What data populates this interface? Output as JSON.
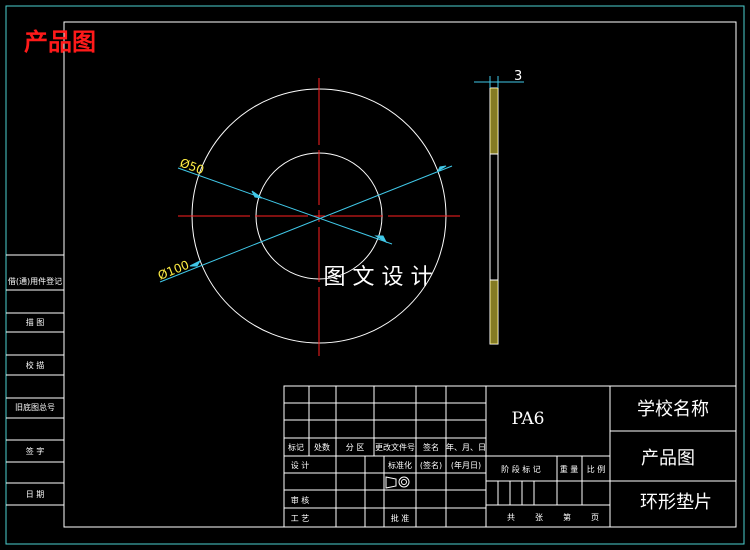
{
  "title": "产品图",
  "watermark": "图 文 设 计",
  "dimensions": {
    "inner_diameter": "Ø50",
    "outer_diameter": "Ø100",
    "thickness": "3"
  },
  "left_strip": [
    "借(通)用件登记",
    "描 图",
    "校 描",
    "旧底图总号",
    "签 字",
    "日 期"
  ],
  "title_block": {
    "material": "PA6",
    "school": "学校名称",
    "drawing_name": "产品图",
    "part_name": "环形垫片",
    "rev_headers": [
      "标记",
      "处数",
      "分 区",
      "更改文件号",
      "签名",
      "年、月、日"
    ],
    "design_row": [
      "设 计",
      "标准化",
      "(签名)",
      "(年月日)"
    ],
    "stage_headers": [
      "阶 段 标 记",
      "重 量",
      "比 例"
    ],
    "review": "审 核",
    "process": "工 艺",
    "approve": "批 准",
    "sheet": [
      "共",
      "张",
      "第",
      "页"
    ]
  },
  "colors": {
    "frame": "#4dd0d0",
    "geometry": "#ffffff",
    "centerline": "#ff2020",
    "dimension": "#40c8e8",
    "title_red": "#ff1a1a",
    "hatch": "#f0e040"
  }
}
